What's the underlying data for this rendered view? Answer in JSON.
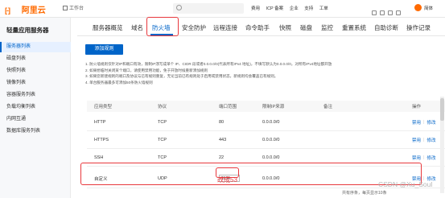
{
  "header": {
    "logo_mark": "[-]",
    "brand": "阿里云",
    "workspace": "工作台",
    "search_placeholder": "",
    "nav": [
      "费用",
      "ICP 备案",
      "企业",
      "支持",
      "工单"
    ],
    "username": "简体"
  },
  "sidebar": {
    "title": "轻量应用服务器",
    "items": [
      {
        "label": "服务器列表",
        "active": true
      },
      {
        "label": "磁盘列表",
        "active": false
      },
      {
        "label": "快照列表",
        "active": false
      },
      {
        "label": "镜像列表",
        "active": false
      },
      {
        "label": "容器服务列表",
        "active": false
      },
      {
        "label": "负载均衡列表",
        "active": false
      },
      {
        "label": "内网互通",
        "active": false
      },
      {
        "label": "数据库服务列表",
        "active": false
      }
    ]
  },
  "tabs": [
    {
      "label": "服务器概览"
    },
    {
      "label": "域名"
    },
    {
      "label": "防火墙",
      "active": true
    },
    {
      "label": "安全防护"
    },
    {
      "label": "远程连接"
    },
    {
      "label": "命令助手"
    },
    {
      "label": "快照"
    },
    {
      "label": "磁盘"
    },
    {
      "label": "监控"
    },
    {
      "label": "重置系统"
    },
    {
      "label": "自助诊断"
    },
    {
      "label": "操作记录"
    }
  ],
  "add_rule_button": "添加规则",
  "notes": [
    "1. 防火墙规则仅针对IP和端口有效，限制IP须写成单个 IP、CIDR 段或者0.0.0.0/0(代表所有IPv4 地址)，不填写默认为0.0.0.0/0，对所有IPv4地址都开放",
    "2. 如果想临时关闭某个端口，请使用禁用功能，免于开放时候重新添加规则",
    "3. 如果您新建规则的端口及协议与已有规则重复，无论当前已有规则处于启用或禁用状态，新规则均会覆盖已有规则。",
    "4. 单台服务器最多可添加50条防火墙规则"
  ],
  "table": {
    "headers": [
      "应用类型",
      "协议",
      "端口范围",
      "限制IP来源",
      "备注",
      "操作"
    ],
    "rows": [
      {
        "app": "HTTP",
        "protocol": "TCP",
        "port": "80",
        "source": "0.0.0.0/0",
        "remark": "",
        "disable": "禁用",
        "edit": "修改"
      },
      {
        "app": "HTTPS",
        "protocol": "TCP",
        "port": "443",
        "source": "0.0.0.0/0",
        "remark": "",
        "disable": "禁用",
        "edit": "修改"
      },
      {
        "app": "SSH",
        "protocol": "TCP",
        "port": "22",
        "source": "0.0.0.0/0",
        "remark": "",
        "disable": "禁用",
        "edit": "修改"
      },
      {
        "app": "自定义",
        "protocol": "UDP",
        "port": "1194",
        "source": "0.0.0.0/0",
        "remark": "",
        "disable": "禁用",
        "edit": "修改"
      }
    ]
  },
  "annotation": "改成53",
  "pager": "共有序条，每页显示10条",
  "watermark": "CSDN @Xu_Soul",
  "colors": {
    "accent": "#0064c8",
    "brand": "#ff6a00",
    "highlight": "#e8383d"
  }
}
